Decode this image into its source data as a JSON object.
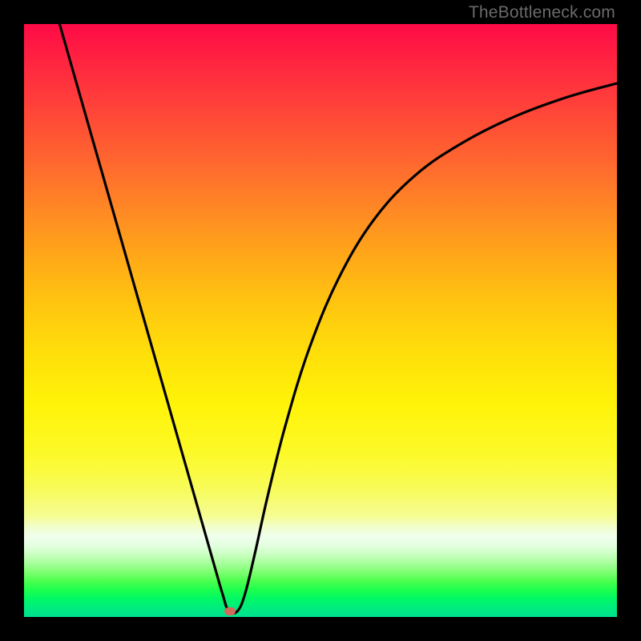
{
  "watermark": "TheBottleneck.com",
  "marker": {
    "x_frac": 0.347,
    "y_frac": 0.99
  },
  "chart_data": {
    "type": "line",
    "title": "",
    "xlabel": "",
    "ylabel": "",
    "xlim": [
      0,
      1
    ],
    "ylim": [
      0,
      1
    ],
    "series": [
      {
        "name": "bottleneck-curve",
        "x": [
          0.06,
          0.09,
          0.12,
          0.15,
          0.18,
          0.21,
          0.24,
          0.27,
          0.3,
          0.322,
          0.335,
          0.345,
          0.36,
          0.373,
          0.39,
          0.41,
          0.44,
          0.48,
          0.53,
          0.59,
          0.66,
          0.74,
          0.83,
          0.92,
          1.0
        ],
        "y": [
          1.0,
          0.895,
          0.79,
          0.685,
          0.58,
          0.475,
          0.37,
          0.265,
          0.16,
          0.083,
          0.038,
          0.01,
          0.01,
          0.04,
          0.11,
          0.2,
          0.32,
          0.45,
          0.57,
          0.67,
          0.745,
          0.8,
          0.845,
          0.878,
          0.9
        ]
      }
    ],
    "annotations": [
      {
        "type": "marker",
        "x": 0.347,
        "y": 0.01,
        "label": "optimal-point"
      }
    ]
  }
}
